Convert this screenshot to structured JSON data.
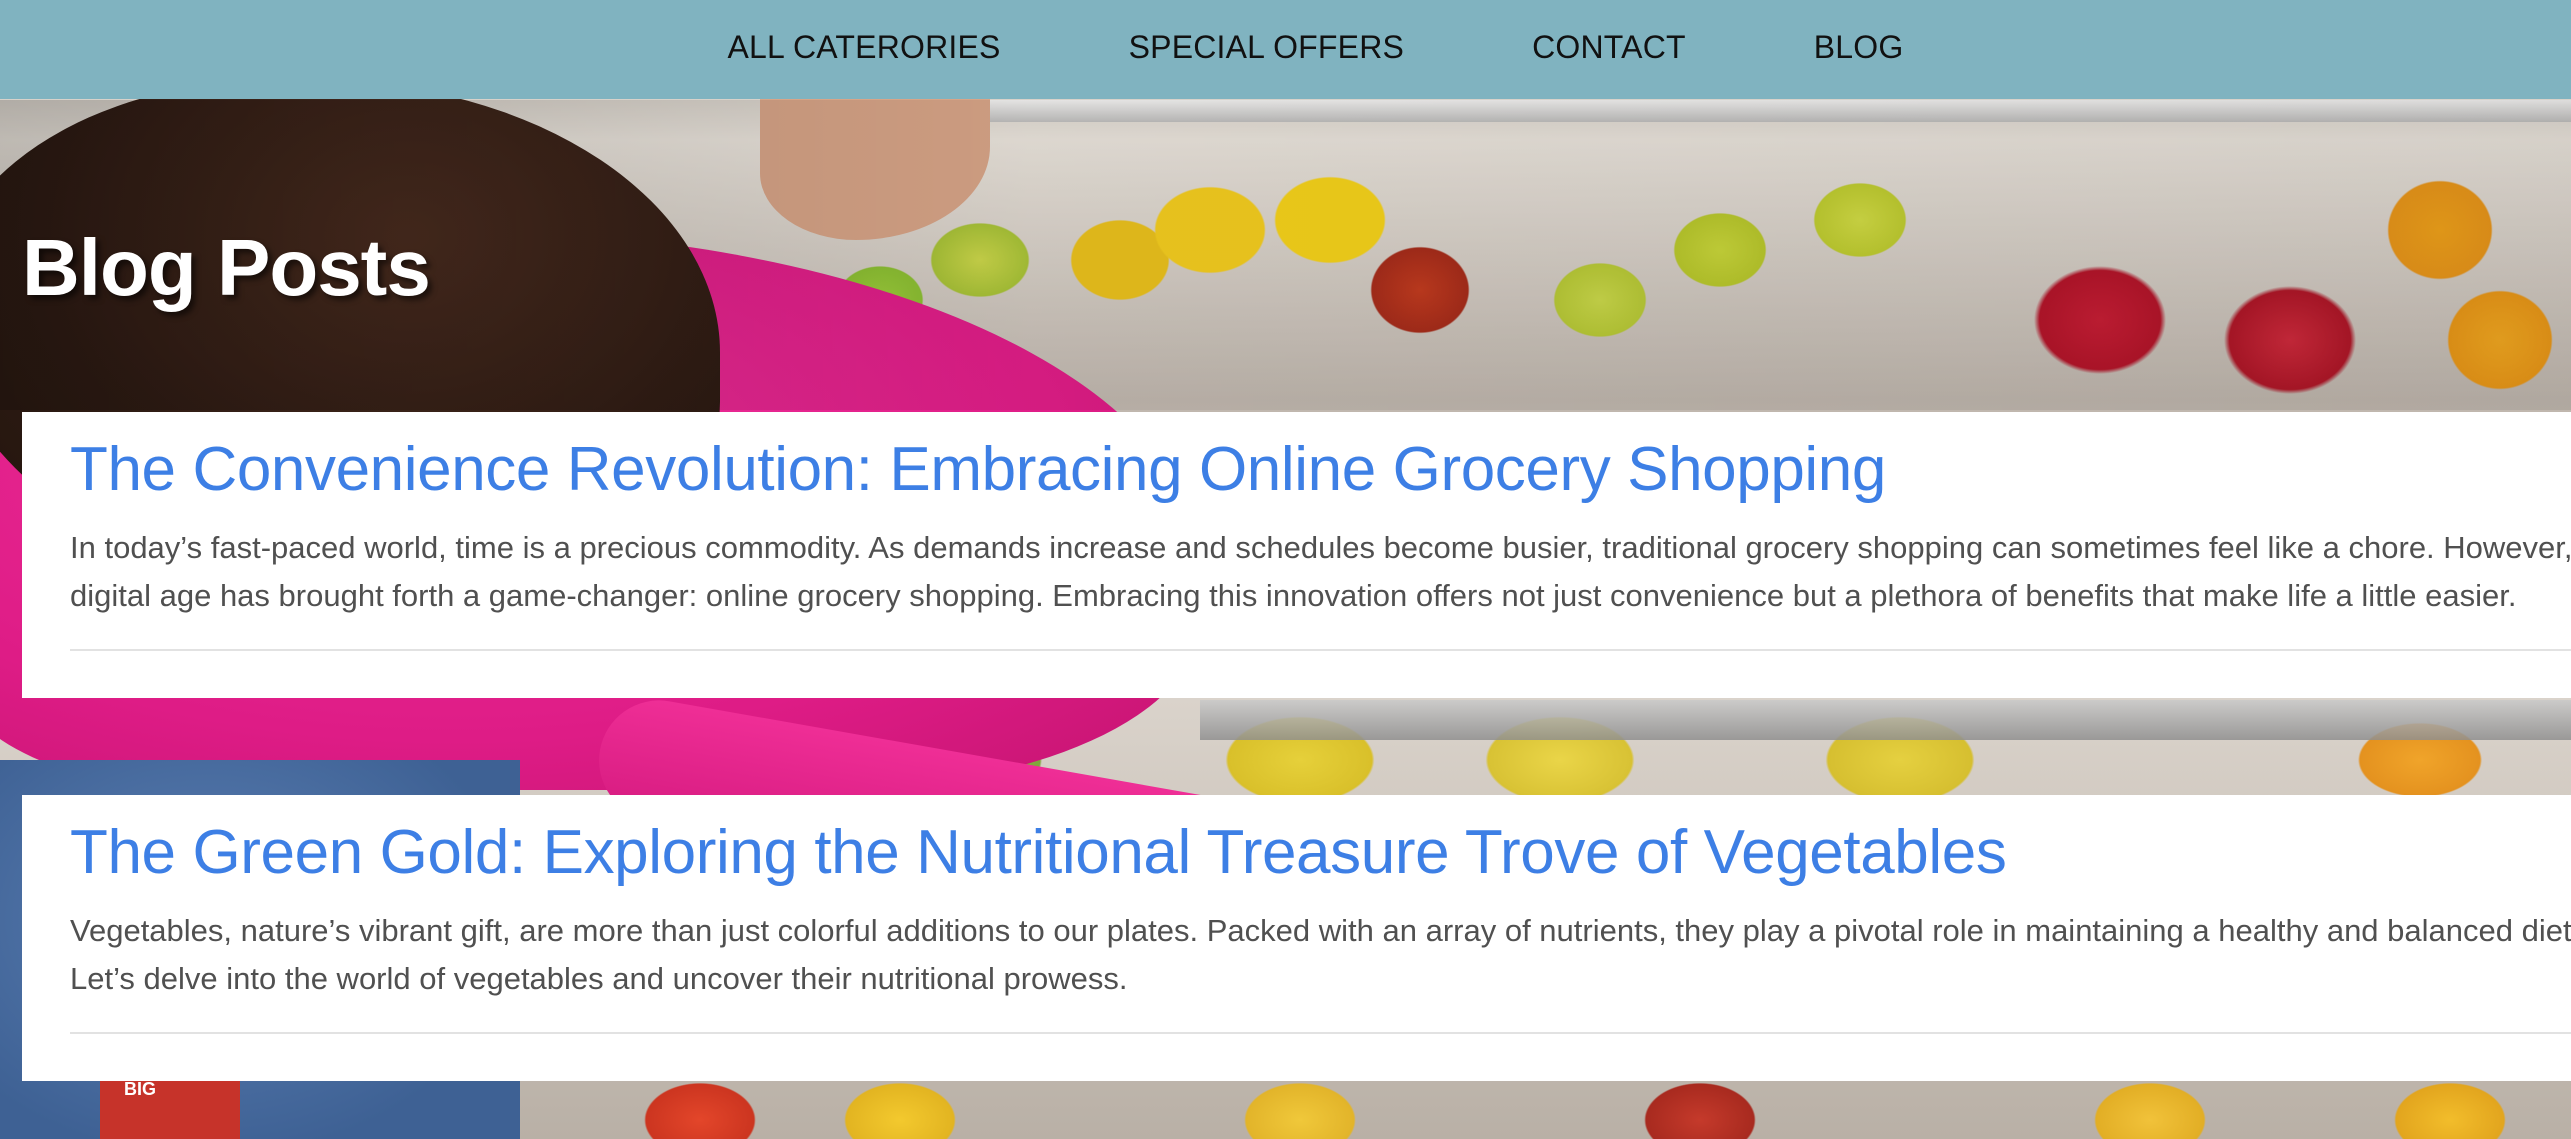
{
  "nav": {
    "items": [
      {
        "label": "ALL CATERORIES"
      },
      {
        "label": "SPECIAL OFFERS"
      },
      {
        "label": "CONTACT"
      },
      {
        "label": "BLOG"
      }
    ]
  },
  "page": {
    "title": "Blog Posts"
  },
  "posts": [
    {
      "title": "The Convenience Revolution: Embracing Online Grocery Shopping",
      "excerpt_line1": "In today’s fast-paced world, time is a precious commodity. As demands increase and schedules become busier, traditional grocery shopping can sometimes feel like a chore. However, the",
      "excerpt_line2": "digital age has brought forth a game-changer: online grocery shopping. Embracing this innovation offers not just convenience but a plethora of benefits that make life a little easier."
    },
    {
      "title": "The Green Gold: Exploring the Nutritional Treasure Trove of Vegetables",
      "excerpt_line1": "Vegetables, nature’s vibrant gift, are more than just colorful additions to our plates. Packed with an array of nutrients, they play a pivotal role in maintaining a healthy and balanced diet.",
      "excerpt_line2": "Let’s delve into the world of vegetables and uncover their nutritional prowess."
    }
  ],
  "decor": {
    "bag_text": "BIG"
  },
  "colors": {
    "nav_bg": "#80b3c0",
    "link": "#3d7fe5",
    "excerpt": "#505050"
  }
}
